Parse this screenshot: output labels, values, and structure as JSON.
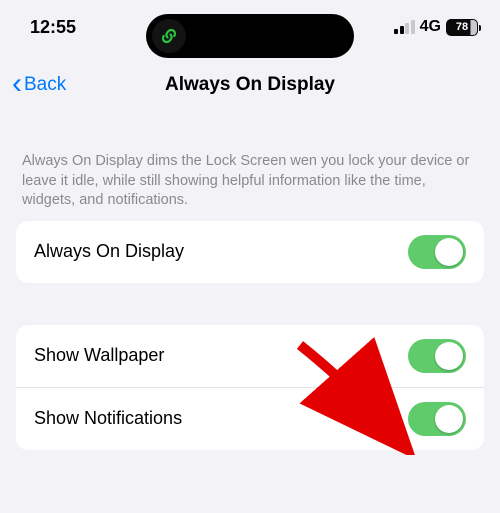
{
  "status": {
    "time": "12:55",
    "network": "4G",
    "battery": "78"
  },
  "nav": {
    "back": "Back",
    "title": "Always On Display"
  },
  "description": "Always On Display dims the Lock Screen wen you lock your device or leave it idle, while still showing helpful information like the time, widgets, and notifications.",
  "rows": {
    "aod": "Always On Display",
    "wallpaper": "Show Wallpaper",
    "notifications": "Show Notifications"
  }
}
